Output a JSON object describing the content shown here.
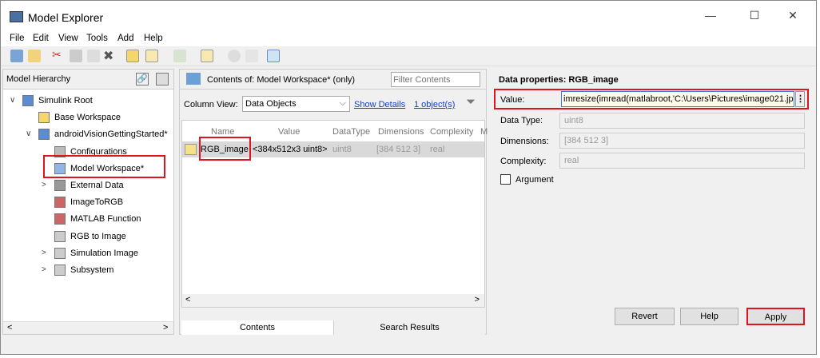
{
  "window": {
    "title": "Model Explorer",
    "minimize": "—",
    "maximize": "☐",
    "close": "✕"
  },
  "menu": [
    "File",
    "Edit",
    "View",
    "Tools",
    "Add",
    "Help"
  ],
  "left": {
    "title": "Model Hierarchy",
    "tree": [
      {
        "label": "Simulink Root",
        "level": 0,
        "chev": "∨"
      },
      {
        "label": "Base Workspace",
        "level": 1,
        "chev": ""
      },
      {
        "label": "androidVisionGettingStarted*",
        "level": 1,
        "chev": "∨"
      },
      {
        "label": "Configurations",
        "level": 2,
        "chev": ""
      },
      {
        "label": "Model Workspace*",
        "level": 2,
        "chev": ""
      },
      {
        "label": "External Data",
        "level": 2,
        "chev": ">"
      },
      {
        "label": "ImageToRGB",
        "level": 2,
        "chev": ""
      },
      {
        "label": "MATLAB Function",
        "level": 2,
        "chev": ""
      },
      {
        "label": "RGB to Image",
        "level": 2,
        "chev": ""
      },
      {
        "label": "Simulation Image",
        "level": 2,
        "chev": ">"
      },
      {
        "label": "Subsystem",
        "level": 2,
        "chev": ">"
      }
    ]
  },
  "middle": {
    "contents_of": "Contents of:  Model Workspace*  (only)",
    "filter_placeholder": "Filter Contents",
    "column_view_label": "Column View:",
    "column_view_value": "Data Objects",
    "show_details": "Show Details",
    "object_count": "1 object(s)",
    "columns": [
      "Name",
      "Value",
      "DataType",
      "Dimensions",
      "Complexity",
      "M"
    ],
    "rows": [
      [
        "RGB_image",
        "<384x512x3 uint8>",
        "uint8",
        "[384 512 3]",
        "real"
      ]
    ],
    "tabs": [
      "Contents",
      "Search Results"
    ]
  },
  "right": {
    "title": "Data properties: RGB_image",
    "value_label": "Value:",
    "value": "imresize(imread(matlabroot,'C:\\Users\\Pictures\\image021.jpg'",
    "datatype_label": "Data Type:",
    "datatype": "uint8",
    "dimensions_label": "Dimensions:",
    "dimensions": "[384 512 3]",
    "complexity_label": "Complexity:",
    "complexity": "real",
    "argument_label": "Argument",
    "revert": "Revert",
    "help": "Help",
    "apply": "Apply"
  },
  "colors": {
    "highlight": "#e0141e",
    "link": "#1a3ccf"
  }
}
